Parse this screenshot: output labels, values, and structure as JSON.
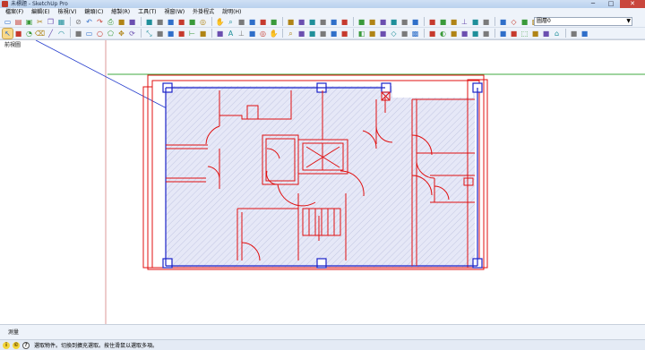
{
  "window": {
    "title": "未標題 - SketchUp Pro"
  },
  "menu": [
    "檔案(F)",
    "編輯(E)",
    "檢視(V)",
    "鏡頭(C)",
    "繪製(R)",
    "工具(T)",
    "視窗(W)",
    "外掛程式",
    "說明(H)"
  ],
  "toolbar1_icons": [
    "new-icon",
    "open-icon",
    "save-icon",
    "cut-icon",
    "copy-icon",
    "paste-icon",
    "erase-icon",
    "undo-icon",
    "redo-icon",
    "print-icon",
    "shadow-icon",
    "fog-icon",
    "time-slider-icon",
    "section-icon",
    "layer-icon",
    "soften-icon",
    "outliner-icon",
    "orbit-icon",
    "pan-icon",
    "zoom-icon",
    "zoom-window-icon",
    "zoom-extents-icon",
    "previous-view-icon",
    "next-view-icon",
    "standard-view-icon",
    "materials-icon",
    "components-icon",
    "styles-icon",
    "scenes-icon",
    "position-camera-icon",
    "walk-icon",
    "look-around-icon",
    "push-pull-icon",
    "follow-me-icon",
    "offset-icon",
    "sandbox-icon",
    "dimension-icon",
    "tape-icon",
    "protractor-icon",
    "axes-icon",
    "3d-text-icon",
    "xray-icon",
    "back-edges-icon",
    "wireframe-icon",
    "hidden-line-icon",
    "shaded-icon",
    "textures-icon",
    "monochrome-icon"
  ],
  "toolbar2_icons": [
    "select-icon",
    "make-component-icon",
    "paint-bucket-icon",
    "eraser-icon",
    "line-icon",
    "arc-icon",
    "freehand-icon",
    "rectangle-icon",
    "circle-icon",
    "polygon-icon",
    "move-icon",
    "rotate-icon",
    "scale-icon",
    "offset-icon",
    "push-pull-icon",
    "follow-me-icon",
    "tape-measure-icon",
    "dimension-icon",
    "protractor-icon",
    "text-icon",
    "axes-icon",
    "3d-text-icon",
    "orbit-icon",
    "pan-icon",
    "zoom-icon",
    "zoom-window-icon",
    "zoom-extents-icon",
    "position-camera-icon",
    "walk-icon",
    "look-around-icon",
    "section-plane-icon",
    "xray-icon",
    "back-edges-icon",
    "wireframe-icon",
    "hidden-line-icon",
    "shaded-icon",
    "shaded-textures-icon",
    "monochrome-icon",
    "iso-view-icon",
    "top-view-icon",
    "front-view-icon",
    "right-view-icon",
    "back-view-icon",
    "left-view-icon",
    "perspective-icon",
    "geo-location-icon",
    "photo-texture-icon",
    "warehouse-icon",
    "share-model-icon",
    "extension-icon"
  ],
  "layer": {
    "current": "圖層0"
  },
  "viewport": {
    "label": "前視圖"
  },
  "measurements": {
    "label": "測量"
  },
  "status": {
    "message": "選取物件。切換到擴充選取。按住滑鼠以選取多項。"
  },
  "colors": {
    "plan_red": "#e01010",
    "plan_blue": "#1a22c8",
    "fill": "#e5e7f6",
    "axis_green": "#3faa3f"
  }
}
